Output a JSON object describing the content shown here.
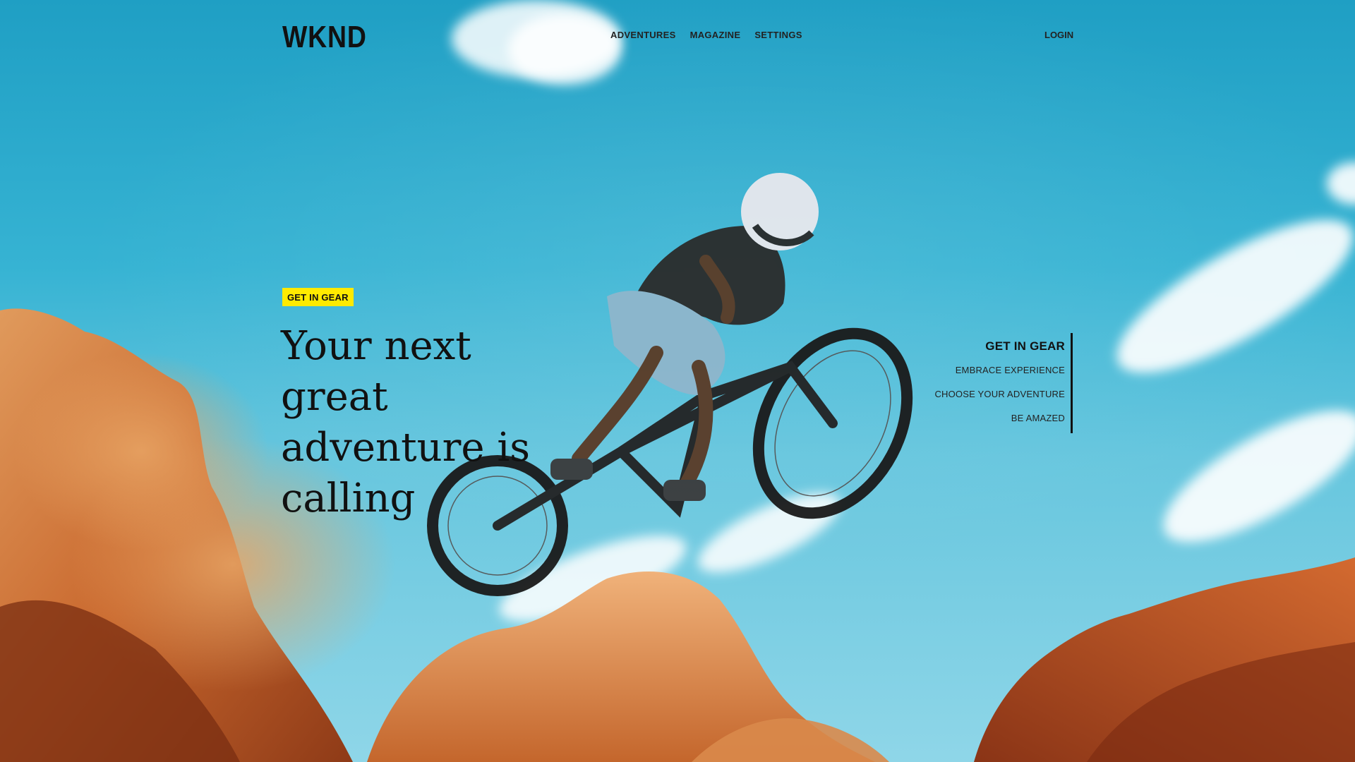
{
  "header": {
    "logo": "WKND",
    "nav": [
      "ADVENTURES",
      "MAGAZINE",
      "SETTINGS"
    ],
    "login": "LOGIN"
  },
  "hero": {
    "badge": "GET IN GEAR",
    "headline": "Your next great adventure is calling",
    "image": "mountain-biker-jumping-over-desert-rocks"
  },
  "carousel": {
    "items": [
      "GET IN GEAR",
      "EMBRACE EXPERIENCE",
      "CHOOSE YOUR ADVENTURE",
      "BE AMAZED"
    ],
    "active_index": 0
  },
  "colors": {
    "badge_bg": "#ffea00",
    "sky": "#2fa7c9",
    "rock": "#c8622a",
    "text": "#111111"
  }
}
